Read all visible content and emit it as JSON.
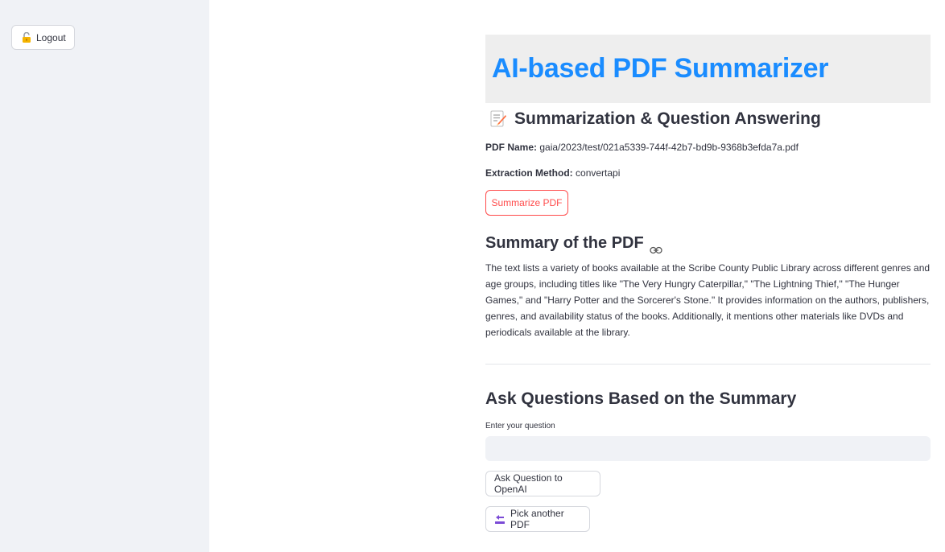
{
  "sidebar": {
    "logout_label": "Logout",
    "logout_icon": "unlocked-lock-icon"
  },
  "main": {
    "title": "AI-based PDF Summarizer",
    "subheader": "Summarization & Question Answering",
    "subheader_icon": "memo-icon",
    "pdf_name_label": "PDF Name:",
    "pdf_name_value": "gaia/2023/test/021a5339-744f-42b7-bd9b-9368b3efda7a.pdf",
    "extraction_label": "Extraction Method:",
    "extraction_value": "convertapi",
    "summarize_button": "Summarize PDF",
    "summary_heading": "Summary of the PDF",
    "summary_text": "The text lists a variety of books available at the Scribe County Public Library across different genres and age groups, including titles like \"The Very Hungry Caterpillar,\" \"The Lightning Thief,\" \"The Hunger Games,\" and \"Harry Potter and the Sorcerer's Stone.\" It provides information on the authors, publishers, genres, and availability status of the books. Additionally, it mentions other materials like DVDs and periodicals available at the library.",
    "qa_heading": "Ask Questions Based on the Summary",
    "question_label": "Enter your question",
    "question_value": "",
    "ask_button": "Ask Question to OpenAI",
    "pick_button": "Pick another PDF",
    "pick_icon": "back-arrow-icon"
  },
  "colors": {
    "title": "#1a8cff",
    "primary": "#ff4b4b",
    "sidebar_bg": "#f0f2f6",
    "title_bg": "#eeeeee"
  }
}
